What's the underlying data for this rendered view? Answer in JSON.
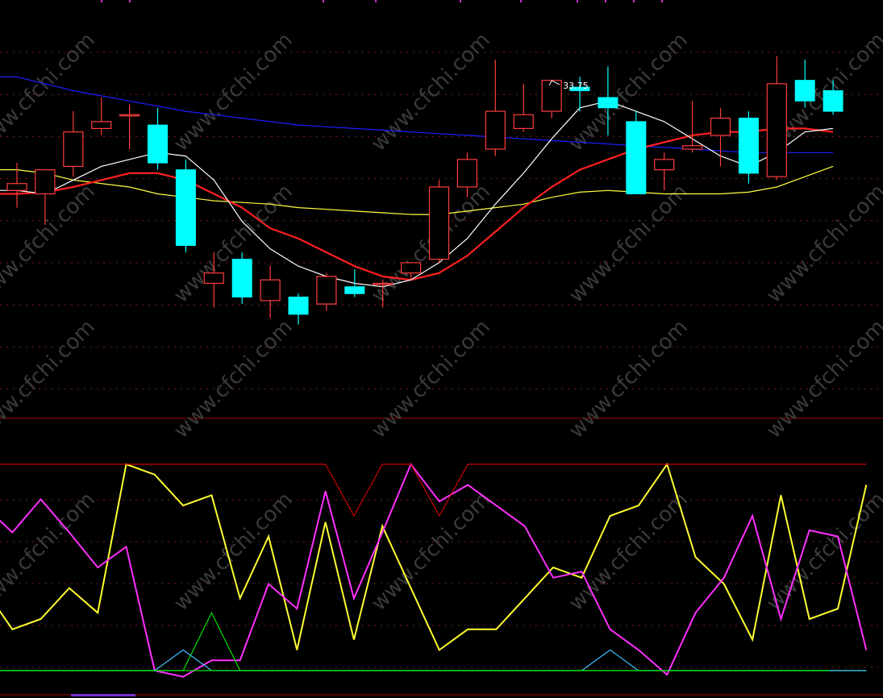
{
  "watermark": "www.cfchi.com",
  "chart_data": [
    {
      "type": "candlestick",
      "panel": "price",
      "annotations": [
        {
          "text": "33.75",
          "index": 19
        }
      ],
      "colors": {
        "up": "#ff3c3c",
        "down": "#00ffff",
        "ma5": "#ffffff",
        "ma10": "#ff2020",
        "ma20": "#ffff40",
        "ma60": "#1e1eff",
        "grid": "#7a1f1f",
        "border": "#aa0000"
      },
      "price_range": [
        24.1,
        36.0
      ],
      "candles": [
        {
          "open": 30.7,
          "high": 31.5,
          "low": 30.2,
          "close": 30.9
        },
        {
          "open": 30.6,
          "high": 31.1,
          "low": 29.7,
          "close": 31.3
        },
        {
          "open": 31.4,
          "high": 33.0,
          "low": 31.1,
          "close": 32.4
        },
        {
          "open": 32.5,
          "high": 33.4,
          "low": 32.3,
          "close": 32.7
        },
        {
          "open": 32.9,
          "high": 33.2,
          "low": 31.9,
          "close": 32.9
        },
        {
          "open": 32.6,
          "high": 33.1,
          "low": 31.3,
          "close": 31.5
        },
        {
          "open": 31.3,
          "high": 31.6,
          "low": 28.9,
          "close": 29.1
        },
        {
          "open": 28.0,
          "high": 28.9,
          "low": 27.3,
          "close": 28.3
        },
        {
          "open": 28.7,
          "high": 28.9,
          "low": 27.4,
          "close": 27.6
        },
        {
          "open": 27.5,
          "high": 28.5,
          "low": 27.0,
          "close": 28.1
        },
        {
          "open": 27.6,
          "high": 27.7,
          "low": 26.8,
          "close": 27.1
        },
        {
          "open": 27.4,
          "high": 28.3,
          "low": 27.2,
          "close": 28.2
        },
        {
          "open": 27.9,
          "high": 28.4,
          "low": 27.6,
          "close": 27.7
        },
        {
          "open": 28.0,
          "high": 28.1,
          "low": 27.3,
          "close": 28.0
        },
        {
          "open": 28.3,
          "high": 28.6,
          "low": 28.1,
          "close": 28.6
        },
        {
          "open": 28.7,
          "high": 31.0,
          "low": 28.6,
          "close": 30.8
        },
        {
          "open": 30.8,
          "high": 31.8,
          "low": 30.5,
          "close": 31.6
        },
        {
          "open": 31.9,
          "high": 34.5,
          "low": 31.7,
          "close": 33.0
        },
        {
          "open": 32.5,
          "high": 33.8,
          "low": 32.4,
          "close": 32.9
        },
        {
          "open": 33.0,
          "high": 33.75,
          "low": 32.8,
          "close": 33.9
        },
        {
          "open": 33.7,
          "high": 34.0,
          "low": 33.0,
          "close": 33.6
        },
        {
          "open": 33.4,
          "high": 34.3,
          "low": 32.3,
          "close": 33.1
        },
        {
          "open": 32.7,
          "high": 33.0,
          "low": 30.6,
          "close": 30.6
        },
        {
          "open": 31.3,
          "high": 31.8,
          "low": 30.7,
          "close": 31.6
        },
        {
          "open": 31.9,
          "high": 33.3,
          "low": 31.8,
          "close": 32.0
        },
        {
          "open": 32.3,
          "high": 33.1,
          "low": 31.4,
          "close": 32.8
        },
        {
          "open": 32.8,
          "high": 33.0,
          "low": 30.9,
          "close": 31.2
        },
        {
          "open": 31.1,
          "high": 34.6,
          "low": 31.0,
          "close": 33.8
        },
        {
          "open": 33.9,
          "high": 34.5,
          "low": 33.1,
          "close": 33.3
        },
        {
          "open": 33.6,
          "high": 33.9,
          "low": 32.9,
          "close": 33.0
        }
      ],
      "ma5": [
        30.7,
        30.6,
        31.0,
        31.4,
        31.6,
        31.8,
        31.7,
        31.0,
        29.8,
        29.0,
        28.5,
        28.2,
        28.0,
        27.9,
        28.1,
        28.6,
        29.3,
        30.3,
        31.2,
        32.2,
        33.1,
        33.3,
        33.0,
        32.7,
        32.2,
        31.7,
        31.4,
        31.8,
        32.4,
        32.5
      ],
      "ma10": [
        30.6,
        30.65,
        30.8,
        31.0,
        31.2,
        31.2,
        31.0,
        30.6,
        30.2,
        29.6,
        29.3,
        28.9,
        28.5,
        28.2,
        28.1,
        28.3,
        28.8,
        29.5,
        30.2,
        30.8,
        31.3,
        31.6,
        31.9,
        32.1,
        32.3,
        32.4,
        32.4,
        32.5,
        32.5,
        32.4
      ],
      "ma20": [
        31.3,
        31.2,
        31.0,
        30.9,
        30.8,
        30.6,
        30.5,
        30.4,
        30.35,
        30.3,
        30.2,
        30.15,
        30.1,
        30.05,
        30.0,
        30.0,
        30.1,
        30.2,
        30.3,
        30.5,
        30.65,
        30.7,
        30.65,
        30.6,
        30.6,
        30.6,
        30.65,
        30.8,
        31.1,
        31.4
      ],
      "ma60": [
        34.0,
        33.8,
        33.6,
        33.45,
        33.3,
        33.15,
        33.0,
        32.9,
        32.8,
        32.7,
        32.6,
        32.55,
        32.5,
        32.45,
        32.4,
        32.35,
        32.3,
        32.25,
        32.2,
        32.15,
        32.1,
        32.05,
        32.0,
        31.95,
        31.9,
        31.85,
        31.8,
        31.8,
        31.8,
        31.8
      ]
    },
    {
      "type": "line",
      "panel": "indicator",
      "y_range": [
        -3,
        100
      ],
      "series": [
        {
          "color": "#ffff30",
          "values": [
            40,
            20,
            25,
            40,
            28,
            100,
            95,
            80,
            85,
            35,
            65,
            10,
            72,
            15,
            70,
            40,
            10,
            20,
            20,
            35,
            50,
            45,
            75,
            80,
            100,
            55,
            42,
            15,
            85,
            25,
            30,
            90
          ]
        },
        {
          "color": "#ff30ff",
          "values": [
            80,
            67,
            83,
            67,
            50,
            60,
            0,
            -3,
            5,
            5,
            42,
            30,
            87,
            35,
            67,
            100,
            82,
            90,
            80,
            70,
            45,
            48,
            20,
            10,
            -2,
            28,
            45,
            75,
            25,
            68,
            65,
            10
          ]
        },
        {
          "color": "#00e000",
          "values": [
            0,
            0,
            0,
            0,
            0,
            0,
            0,
            0,
            28,
            0,
            0,
            0,
            0,
            0,
            0,
            0,
            0,
            0,
            0,
            0,
            0,
            0,
            0,
            0,
            0,
            0,
            0,
            0,
            0,
            0,
            0,
            0
          ]
        },
        {
          "color": "#40c0ff",
          "values": [
            0,
            0,
            0,
            0,
            0,
            0,
            0,
            10,
            0,
            0,
            0,
            0,
            0,
            0,
            0,
            0,
            0,
            0,
            0,
            0,
            0,
            0,
            10,
            0,
            0,
            0,
            0,
            0,
            0,
            0,
            0,
            0
          ]
        },
        {
          "color": "#cc0000",
          "values": [
            100,
            100,
            100,
            100,
            100,
            100,
            100,
            100,
            100,
            100,
            100,
            100,
            100,
            75,
            100,
            100,
            75,
            100,
            100,
            100,
            100,
            100,
            100,
            100,
            100,
            100,
            100,
            100,
            100,
            100,
            100,
            100
          ]
        }
      ]
    }
  ]
}
